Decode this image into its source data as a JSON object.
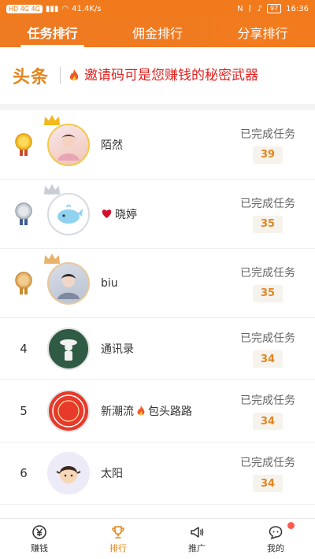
{
  "status_bar": {
    "left": "HD 4G 4G",
    "speed": "41.4K/s",
    "battery": "97",
    "time": "16:36"
  },
  "tabs": [
    {
      "label": "任务排行",
      "active": true
    },
    {
      "label": "佣金排行",
      "active": false
    },
    {
      "label": "分享排行",
      "active": false
    }
  ],
  "banner": {
    "logo": "头条",
    "text": "邀请码可是您赚钱的秘密武器"
  },
  "task_label": "已完成任务",
  "rankings": [
    {
      "rank": "1",
      "medal": "gold",
      "name": "陌然",
      "count": "39"
    },
    {
      "rank": "2",
      "medal": "silver",
      "name": "晓婷",
      "prefix_icon": "heart-icon",
      "count": "35"
    },
    {
      "rank": "3",
      "medal": "bronze",
      "name": "biu",
      "count": "35"
    },
    {
      "rank": "4",
      "name": "通讯录",
      "count": "34"
    },
    {
      "rank": "5",
      "name": "新潮流",
      "name_suffix": "包头路路",
      "count": "34"
    },
    {
      "rank": "6",
      "name": "太阳",
      "count": "34"
    }
  ],
  "bottom_nav": [
    {
      "label": "赚钱",
      "icon": "yen-icon"
    },
    {
      "label": "排行",
      "icon": "trophy-icon",
      "active": true
    },
    {
      "label": "推广",
      "icon": "megaphone-icon"
    },
    {
      "label": "我的",
      "icon": "chat-icon",
      "badge": true
    }
  ],
  "colors": {
    "accent": "#f07a1c",
    "highlight_text": "#e2201e",
    "count_text": "#e2861e"
  }
}
